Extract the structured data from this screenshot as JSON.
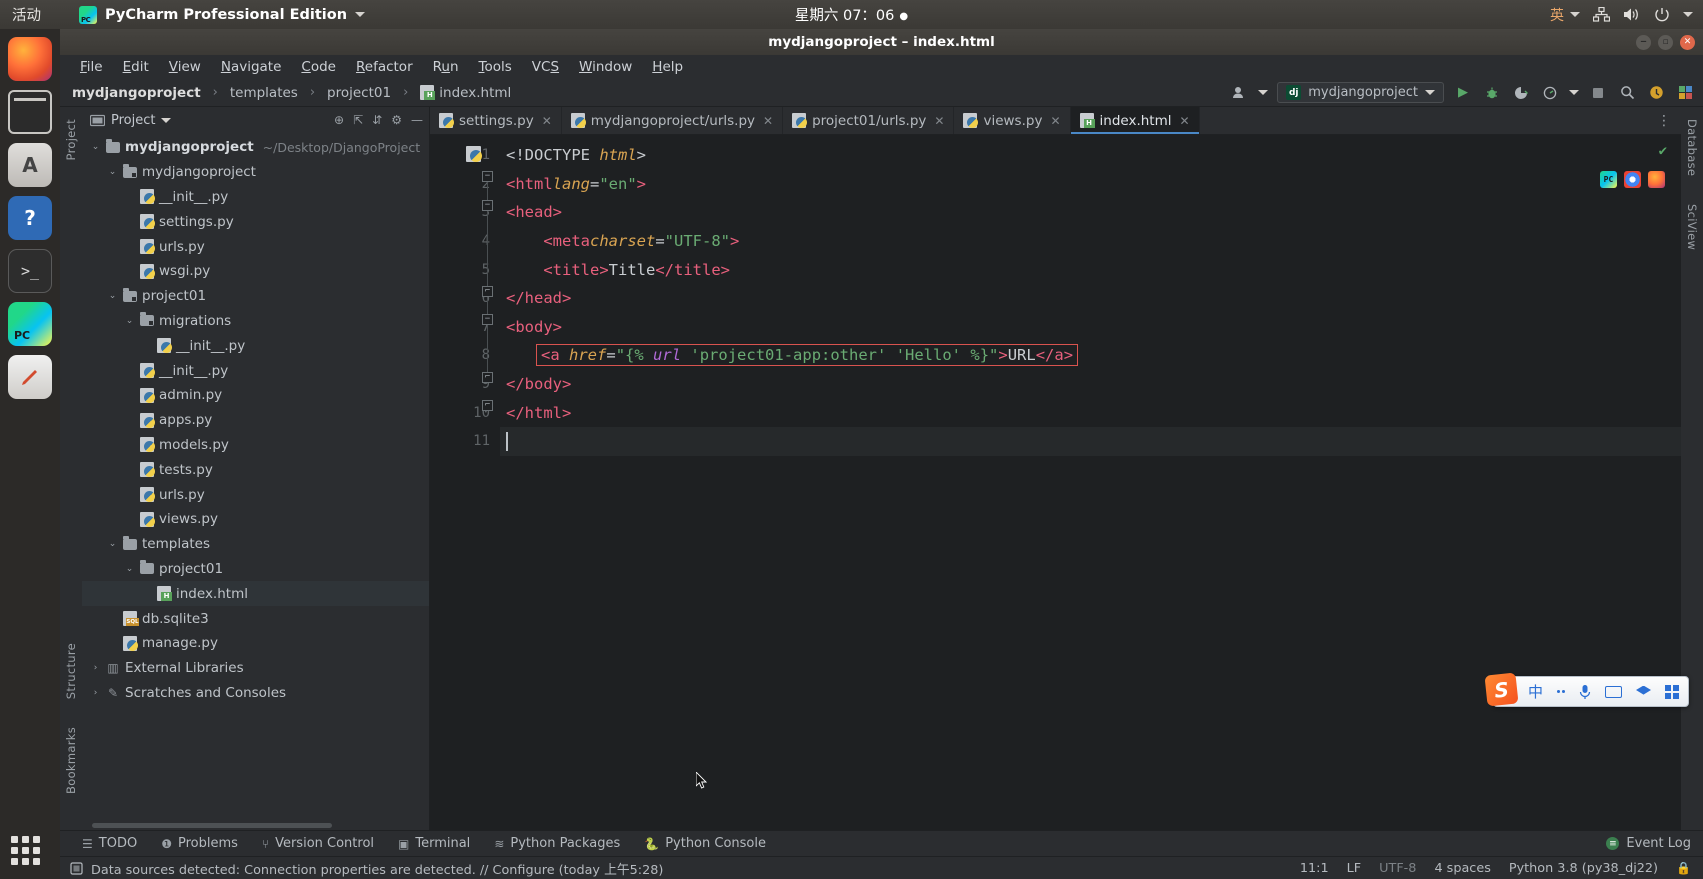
{
  "desktop": {
    "activities": "活动",
    "app_name": "PyCharm Professional Edition",
    "app_icon": "pycharm-logo-icon",
    "clock": "星期六 07：06",
    "lang_indicator": "英",
    "tray_icons": [
      "network-icon",
      "volume-icon",
      "power-icon"
    ],
    "dock": [
      {
        "name": "firefox",
        "label": "Firefox"
      },
      {
        "name": "files",
        "label": "Files"
      },
      {
        "name": "software",
        "label": "Ubuntu Software"
      },
      {
        "name": "help",
        "label": "Help"
      },
      {
        "name": "terminal",
        "label": "Terminal"
      },
      {
        "name": "pycharm",
        "label": "PyCharm"
      },
      {
        "name": "pen",
        "label": "Text Editor"
      }
    ]
  },
  "window": {
    "title": "mydjangoproject – index.html",
    "buttons": [
      "minimize",
      "maximize",
      "close"
    ]
  },
  "menubar": [
    {
      "label": "File",
      "mnemonic": "F"
    },
    {
      "label": "Edit",
      "mnemonic": "E"
    },
    {
      "label": "View",
      "mnemonic": "V"
    },
    {
      "label": "Navigate",
      "mnemonic": "N"
    },
    {
      "label": "Code",
      "mnemonic": "C"
    },
    {
      "label": "Refactor",
      "mnemonic": "R"
    },
    {
      "label": "Run",
      "mnemonic": "u"
    },
    {
      "label": "Tools",
      "mnemonic": "T"
    },
    {
      "label": "VCS",
      "mnemonic": "S"
    },
    {
      "label": "Window",
      "mnemonic": "W"
    },
    {
      "label": "Help",
      "mnemonic": "H"
    }
  ],
  "navbar": {
    "breadcrumb": [
      "mydjangoproject",
      "templates",
      "project01",
      "index.html"
    ],
    "run_config": "mydjangoproject",
    "run_config_icon": "django-icon",
    "actions": [
      "run-icon",
      "debug-icon",
      "coverage-icon",
      "profile-icon",
      "stop-icon",
      "search-icon",
      "updates-icon",
      "plugins-icon"
    ]
  },
  "project_panel": {
    "title": "Project",
    "toolbar_icons": [
      "scroll-from-source-icon",
      "collapse-all-icon",
      "expand-icon",
      "settings-icon",
      "hide-icon"
    ],
    "tree": [
      {
        "depth": 0,
        "label": "mydjangoproject",
        "path": "~/Desktop/DjangoProject",
        "icon": "folder-icon",
        "twist": "expanded",
        "bold": true
      },
      {
        "depth": 1,
        "label": "mydjangoproject",
        "icon": "source-folder-icon",
        "twist": "expanded"
      },
      {
        "depth": 2,
        "label": "__init__.py",
        "icon": "python-file-icon"
      },
      {
        "depth": 2,
        "label": "settings.py",
        "icon": "python-file-icon"
      },
      {
        "depth": 2,
        "label": "urls.py",
        "icon": "python-file-icon"
      },
      {
        "depth": 2,
        "label": "wsgi.py",
        "icon": "python-file-icon"
      },
      {
        "depth": 1,
        "label": "project01",
        "icon": "source-folder-icon",
        "twist": "expanded"
      },
      {
        "depth": 2,
        "label": "migrations",
        "icon": "source-folder-icon",
        "twist": "expanded"
      },
      {
        "depth": 3,
        "label": "__init__.py",
        "icon": "python-file-icon"
      },
      {
        "depth": 2,
        "label": "__init__.py",
        "icon": "python-file-icon"
      },
      {
        "depth": 2,
        "label": "admin.py",
        "icon": "python-file-icon"
      },
      {
        "depth": 2,
        "label": "apps.py",
        "icon": "python-file-icon"
      },
      {
        "depth": 2,
        "label": "models.py",
        "icon": "python-file-icon"
      },
      {
        "depth": 2,
        "label": "tests.py",
        "icon": "python-file-icon"
      },
      {
        "depth": 2,
        "label": "urls.py",
        "icon": "python-file-icon"
      },
      {
        "depth": 2,
        "label": "views.py",
        "icon": "python-file-icon"
      },
      {
        "depth": 1,
        "label": "templates",
        "icon": "folder-icon",
        "twist": "expanded"
      },
      {
        "depth": 2,
        "label": "project01",
        "icon": "folder-icon",
        "twist": "expanded"
      },
      {
        "depth": 3,
        "label": "index.html",
        "icon": "html-file-icon",
        "selected": true
      },
      {
        "depth": 1,
        "label": "db.sqlite3",
        "icon": "sqlite-file-icon"
      },
      {
        "depth": 1,
        "label": "manage.py",
        "icon": "python-file-icon"
      },
      {
        "depth": 0,
        "label": "External Libraries",
        "icon": "library-icon",
        "twist": "collapsed"
      },
      {
        "depth": 0,
        "label": "Scratches and Consoles",
        "icon": "scratches-icon",
        "twist": "collapsed"
      }
    ]
  },
  "rails": {
    "left_top": "Project",
    "left_bottom": [
      "Structure",
      "Bookmarks"
    ],
    "right": [
      "Database",
      "SciView"
    ]
  },
  "editor": {
    "tabs": [
      {
        "label": "settings.py",
        "icon": "python-file-icon",
        "active": false
      },
      {
        "label": "mydjangoproject/urls.py",
        "icon": "python-file-icon",
        "active": false
      },
      {
        "label": "project01/urls.py",
        "icon": "python-file-icon",
        "active": false
      },
      {
        "label": "views.py",
        "icon": "python-file-icon",
        "active": false
      },
      {
        "label": "index.html",
        "icon": "html-file-icon",
        "active": true
      }
    ],
    "lines": [
      {
        "n": "1",
        "text": "<!DOCTYPE html>"
      },
      {
        "n": "2",
        "text": "<html lang=\"en\">"
      },
      {
        "n": "3",
        "text": "<head>"
      },
      {
        "n": "4",
        "text": "    <meta charset=\"UTF-8\">"
      },
      {
        "n": "5",
        "text": "    <title>Title</title>"
      },
      {
        "n": "6",
        "text": "</head>"
      },
      {
        "n": "7",
        "text": "<body>"
      },
      {
        "n": "8",
        "text": "    <a href=\"{% url 'project01-app:other' 'Hello' %}\">URL</a>"
      },
      {
        "n": "9",
        "text": "</body>"
      },
      {
        "n": "10",
        "text": "</html>"
      },
      {
        "n": "11",
        "text": ""
      }
    ],
    "error_line": 8,
    "cursor_line": 11,
    "colors": {
      "tag": "#e8607d",
      "attribute": "#d9a452",
      "string": "#6aab73",
      "text": "#c9cdd1",
      "django_tag": "#b06ad6",
      "error_border": "#d9534f",
      "background": "#1e2022"
    },
    "right_icons": [
      "pycharm-preview-icon",
      "chrome-preview-icon",
      "firefox-preview-icon"
    ],
    "inspection_status": "ok"
  },
  "ime": {
    "logo": "sogou-logo-icon",
    "mode": "中",
    "items": [
      "punctuation-icon",
      "voice-icon",
      "keyboard-icon",
      "skin-icon",
      "apps-icon"
    ]
  },
  "toolwindows": [
    {
      "label": "TODO",
      "icon": "todo-icon"
    },
    {
      "label": "Problems",
      "icon": "problems-icon"
    },
    {
      "label": "Version Control",
      "icon": "branch-icon"
    },
    {
      "label": "Terminal",
      "icon": "terminal-icon"
    },
    {
      "label": "Python Packages",
      "icon": "packages-icon"
    },
    {
      "label": "Python Console",
      "icon": "python-console-icon"
    }
  ],
  "event_log": "Event Log",
  "statusbar": {
    "message": "Data sources detected: Connection properties are detected. // Configure (today 上午5:28)",
    "message_icon": "datasource-icon",
    "caret": "11:1",
    "line_separator": "LF",
    "encoding": "UTF-8",
    "indent": "4 spaces",
    "interpreter": "Python 3.8 (py38_dj22)",
    "lock_icon": "lock-icon"
  }
}
